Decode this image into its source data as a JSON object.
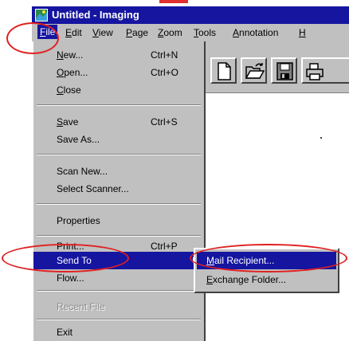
{
  "window": {
    "title": "Untitled - Imaging"
  },
  "menubar": {
    "items": [
      "File",
      "Edit",
      "View",
      "Page",
      "Zoom",
      "Tools",
      "Annotation",
      "H"
    ]
  },
  "file_menu": {
    "new": {
      "label": "New...",
      "shortcut": "Ctrl+N"
    },
    "open": {
      "label": "Open...",
      "shortcut": "Ctrl+O"
    },
    "close": {
      "label": "Close"
    },
    "save": {
      "label": "Save",
      "shortcut": "Ctrl+S"
    },
    "save_as": {
      "label": "Save As..."
    },
    "scan_new": {
      "label": "Scan New..."
    },
    "select_scanner": {
      "label": "Select Scanner..."
    },
    "properties": {
      "label": "Properties"
    },
    "print": {
      "label": "Print...",
      "shortcut": "Ctrl+P"
    },
    "send_to": {
      "label": "Send To"
    },
    "flow": {
      "label": "Flow..."
    },
    "recent_file": {
      "label": "Recent File"
    },
    "exit": {
      "label": "Exit"
    }
  },
  "send_to_submenu": {
    "mail_recipient": "Mail Recipient...",
    "exchange_folder": "Exchange Folder..."
  },
  "toolbar": {
    "icons": [
      "new-document-icon",
      "open-folder-icon",
      "save-disk-icon",
      "print-icon"
    ]
  },
  "colors": {
    "highlight": "#1515a0",
    "menu_face": "#c0c0c0",
    "annotation_red": "#e02020"
  }
}
